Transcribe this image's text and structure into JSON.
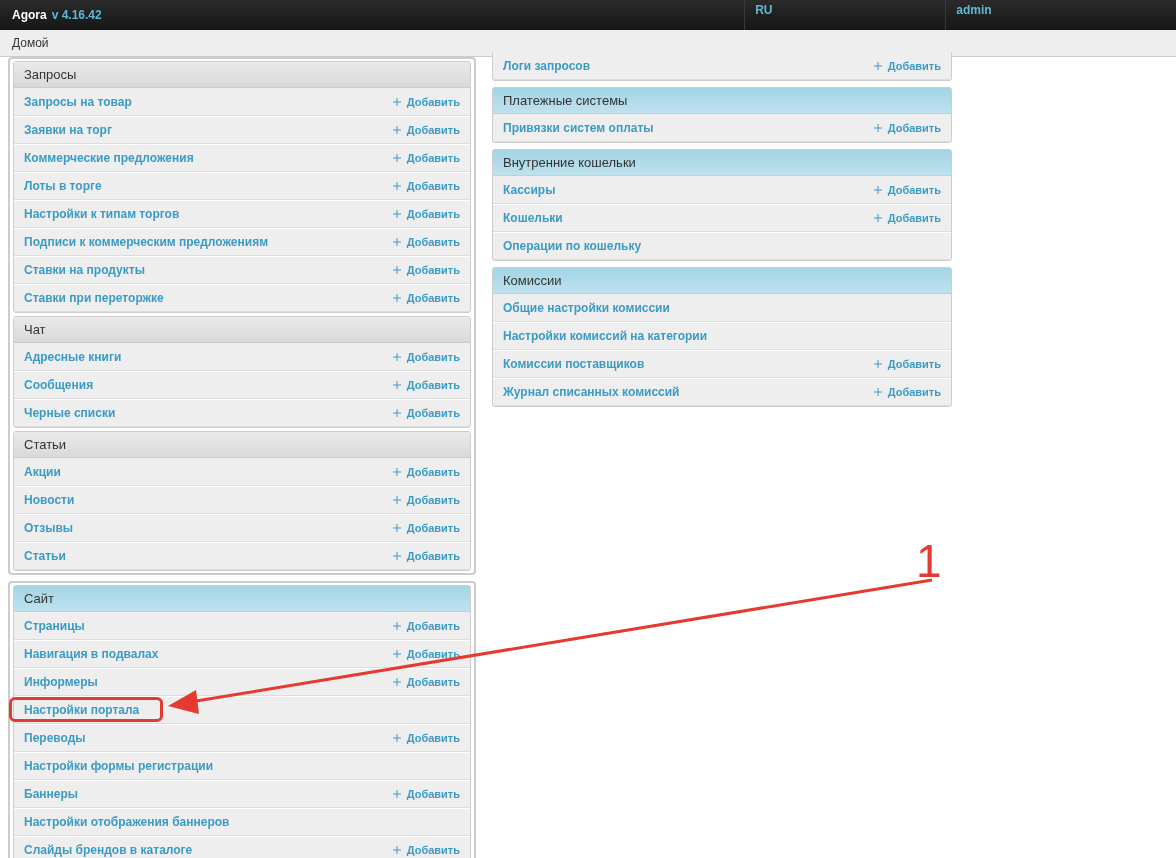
{
  "header": {
    "brand": "Agora",
    "version": "v 4.16.42",
    "language": "RU",
    "user": "admin"
  },
  "breadcrumb": "Домой",
  "left_groups": [
    {
      "modules": [
        {
          "kind": "plain",
          "title": "Запросы",
          "items": [
            {
              "label": "Запросы на товар",
              "add": "Добавить",
              "highlighted": false
            },
            {
              "label": "Заявки на торг",
              "add": "Добавить",
              "highlighted": false
            },
            {
              "label": "Коммерческие предложения",
              "add": "Добавить",
              "highlighted": false
            },
            {
              "label": "Лоты в торге",
              "add": "Добавить",
              "highlighted": false
            },
            {
              "label": "Настройки к типам торгов",
              "add": "Добавить",
              "highlighted": false
            },
            {
              "label": "Подписи к коммерческим предложениям",
              "add": "Добавить",
              "highlighted": false
            },
            {
              "label": "Ставки на продукты",
              "add": "Добавить",
              "highlighted": false
            },
            {
              "label": "Ставки при переторжке",
              "add": "Добавить",
              "highlighted": false
            }
          ]
        },
        {
          "kind": "plain",
          "title": "Чат",
          "items": [
            {
              "label": "Адресные книги",
              "add": "Добавить",
              "highlighted": false
            },
            {
              "label": "Сообщения",
              "add": "Добавить",
              "highlighted": false
            },
            {
              "label": "Черные списки",
              "add": "Добавить",
              "highlighted": false
            }
          ]
        },
        {
          "kind": "plain",
          "title": "Статьи",
          "items": [
            {
              "label": "Акции",
              "add": "Добавить",
              "highlighted": false
            },
            {
              "label": "Новости",
              "add": "Добавить",
              "highlighted": false
            },
            {
              "label": "Отзывы",
              "add": "Добавить",
              "highlighted": false
            },
            {
              "label": "Статьи",
              "add": "Добавить",
              "highlighted": false
            }
          ]
        }
      ]
    },
    {
      "modules": [
        {
          "kind": "accent",
          "title": "Сайт",
          "items": [
            {
              "label": "Страницы",
              "add": "Добавить",
              "highlighted": false
            },
            {
              "label": "Навигация в подвалах",
              "add": "Добавить",
              "highlighted": false
            },
            {
              "label": "Информеры",
              "add": "Добавить",
              "highlighted": false
            },
            {
              "label": "Настройки портала",
              "highlighted": true
            },
            {
              "label": "Переводы",
              "add": "Добавить",
              "highlighted": false
            },
            {
              "label": "Настройки формы регистрации",
              "highlighted": false
            },
            {
              "label": "Баннеры",
              "add": "Добавить",
              "highlighted": false
            },
            {
              "label": "Настройки отображения баннеров",
              "highlighted": false
            },
            {
              "label": "Слайды брендов в каталоге",
              "add": "Добавить",
              "highlighted": false
            }
          ]
        }
      ]
    }
  ],
  "right_modules": [
    {
      "kind": "continued",
      "items": [
        {
          "label": "Логи запросов",
          "add": "Добавить",
          "highlighted": false
        }
      ]
    },
    {
      "kind": "accent",
      "title": "Платежные системы",
      "items": [
        {
          "label": "Привязки систем оплаты",
          "add": "Добавить",
          "highlighted": false
        }
      ]
    },
    {
      "kind": "accent",
      "title": "Внутренние кошельки",
      "items": [
        {
          "label": "Кассиры",
          "add": "Добавить",
          "highlighted": false
        },
        {
          "label": "Кошельки",
          "add": "Добавить",
          "highlighted": false
        },
        {
          "label": "Операции по кошельку",
          "highlighted": false
        }
      ]
    },
    {
      "kind": "accent",
      "title": "Комиссии",
      "items": [
        {
          "label": "Общие настройки комиссии",
          "highlighted": false
        },
        {
          "label": "Настройки комиссий на категории",
          "highlighted": false
        },
        {
          "label": "Комиссии поставщиков",
          "add": "Добавить",
          "highlighted": false
        },
        {
          "label": "Журнал списанных комиссий",
          "add": "Добавить",
          "highlighted": false
        }
      ]
    }
  ],
  "annotation": {
    "label": "1"
  }
}
